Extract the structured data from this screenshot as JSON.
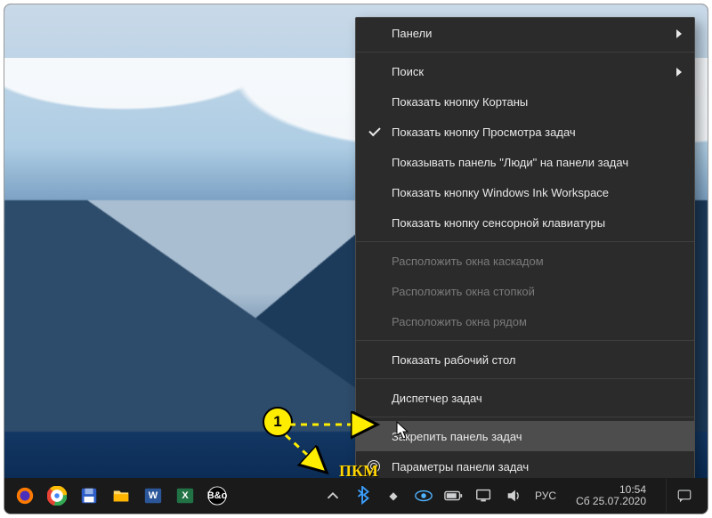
{
  "context_menu": {
    "items": [
      {
        "label": "Панели",
        "type": "submenu"
      },
      {
        "type": "sep"
      },
      {
        "label": "Поиск",
        "type": "submenu"
      },
      {
        "label": "Показать кнопку Кортаны"
      },
      {
        "label": "Показать кнопку Просмотра задач",
        "checked": true
      },
      {
        "label": "Показывать панель \"Люди\" на панели задач"
      },
      {
        "label": "Показать кнопку Windows Ink Workspace"
      },
      {
        "label": "Показать кнопку сенсорной клавиатуры"
      },
      {
        "type": "sep"
      },
      {
        "label": "Расположить окна каскадом",
        "disabled": true
      },
      {
        "label": "Расположить окна стопкой",
        "disabled": true
      },
      {
        "label": "Расположить окна рядом",
        "disabled": true
      },
      {
        "type": "sep"
      },
      {
        "label": "Показать рабочий стол"
      },
      {
        "type": "sep"
      },
      {
        "label": "Диспетчер задач"
      },
      {
        "type": "sep"
      },
      {
        "label": "Закрепить панель задач",
        "highlighted": true
      },
      {
        "label": "Параметры панели задач",
        "icon": "gear"
      }
    ]
  },
  "taskbar": {
    "pinned": [
      {
        "name": "firefox-icon"
      },
      {
        "name": "chrome-icon"
      },
      {
        "name": "save-disk-icon"
      },
      {
        "name": "file-explorer-icon"
      },
      {
        "name": "word-icon",
        "text": "W"
      },
      {
        "name": "excel-icon",
        "text": "X"
      },
      {
        "name": "bang-olufsen-icon",
        "text": "B&o"
      }
    ],
    "tray": [
      {
        "name": "chevron-up-icon"
      },
      {
        "name": "bluetooth-icon"
      },
      {
        "name": "app-tray-icon"
      },
      {
        "name": "eye-icon"
      },
      {
        "name": "battery-icon"
      },
      {
        "name": "network-icon"
      },
      {
        "name": "volume-icon"
      }
    ],
    "language_label": "РУС",
    "time": "10:54",
    "date": "Сб 25.07.2020"
  },
  "annotation": {
    "badge": "1",
    "pkm_label": "ПКМ"
  }
}
